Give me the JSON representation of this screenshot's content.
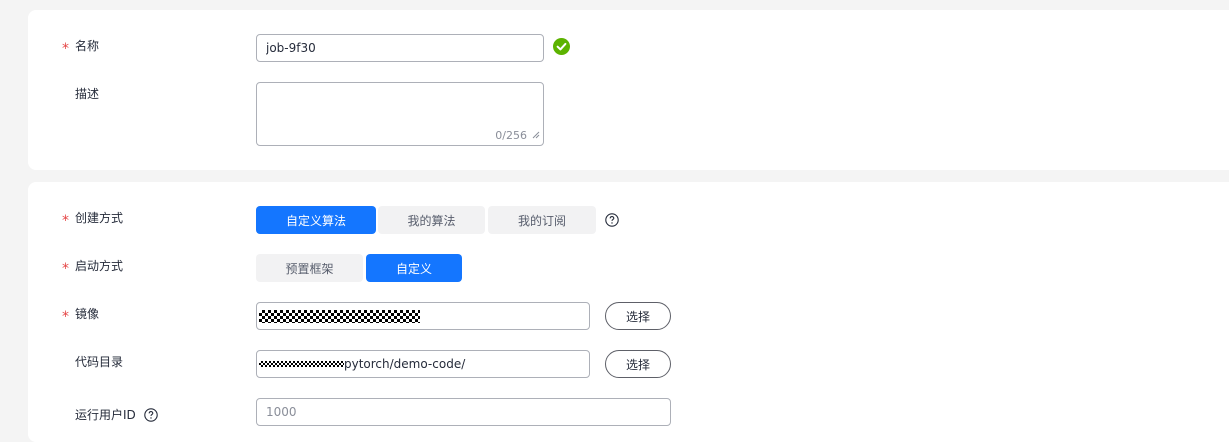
{
  "basic": {
    "name_label": "名称",
    "name_value": "job-9f30",
    "name_valid_icon": "check-circle-icon",
    "desc_label": "描述",
    "desc_counter": "0/256"
  },
  "config": {
    "create_label": "创建方式",
    "create_options": [
      "自定义算法",
      "我的算法",
      "我的订阅"
    ],
    "create_selected": "自定义算法",
    "launch_label": "启动方式",
    "launch_options": [
      "预置框架",
      "自定义"
    ],
    "launch_selected": "自定义",
    "image_label": "镜像",
    "select_label": "选择",
    "code_label": "代码目录",
    "code_value_visible": "pytorch/demo-code/",
    "run_user_label": "运行用户ID",
    "run_user_placeholder": "1000"
  },
  "required_mark": "*",
  "colors": {
    "primary": "#1476ff",
    "success": "#5cb300",
    "required": "#e54545"
  }
}
